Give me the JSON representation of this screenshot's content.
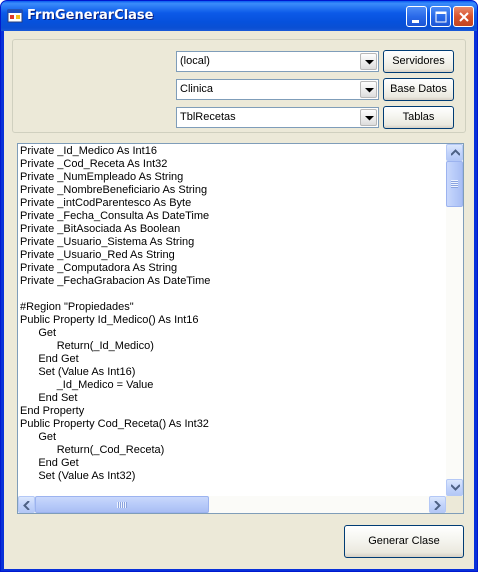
{
  "window": {
    "title": "FrmGenerarClase"
  },
  "selectors": [
    {
      "value": "(local)",
      "button_label": "Servidores"
    },
    {
      "value": "Clinica",
      "button_label": "Base Datos"
    },
    {
      "value": "TblRecetas",
      "button_label": "Tablas"
    }
  ],
  "code_lines": [
    "Private _Id_Medico As Int16",
    "Private _Cod_Receta As Int32",
    "Private _NumEmpleado As String",
    "Private _NombreBeneficiario As String",
    "Private _intCodParentesco As Byte",
    "Private _Fecha_Consulta As DateTime",
    "Private _BitAsociada As Boolean",
    "Private _Usuario_Sistema As String",
    "Private _Usuario_Red As String",
    "Private _Computadora As String",
    "Private _FechaGrabacion As DateTime",
    "",
    "#Region \"Propiedades\"",
    "Public Property Id_Medico() As Int16",
    "\t\tGet",
    "\t\t\t\tReturn(_Id_Medico)",
    "\t\tEnd Get",
    "\t\tSet (Value As Int16)",
    "\t\t\t\t_Id_Medico = Value",
    "\t\tEnd Set",
    "End Property",
    "Public Property Cod_Receta() As Int32",
    "\t\tGet",
    "\t\t\t\tReturn(_Cod_Receta)",
    "\t\tEnd Get",
    "\t\tSet (Value As Int32)"
  ],
  "footer": {
    "generate_label": "Generar Clase"
  },
  "colors": {
    "title_blue": "#0a5df0",
    "face": "#ece9d8",
    "border_blue": "#7f9db9"
  }
}
